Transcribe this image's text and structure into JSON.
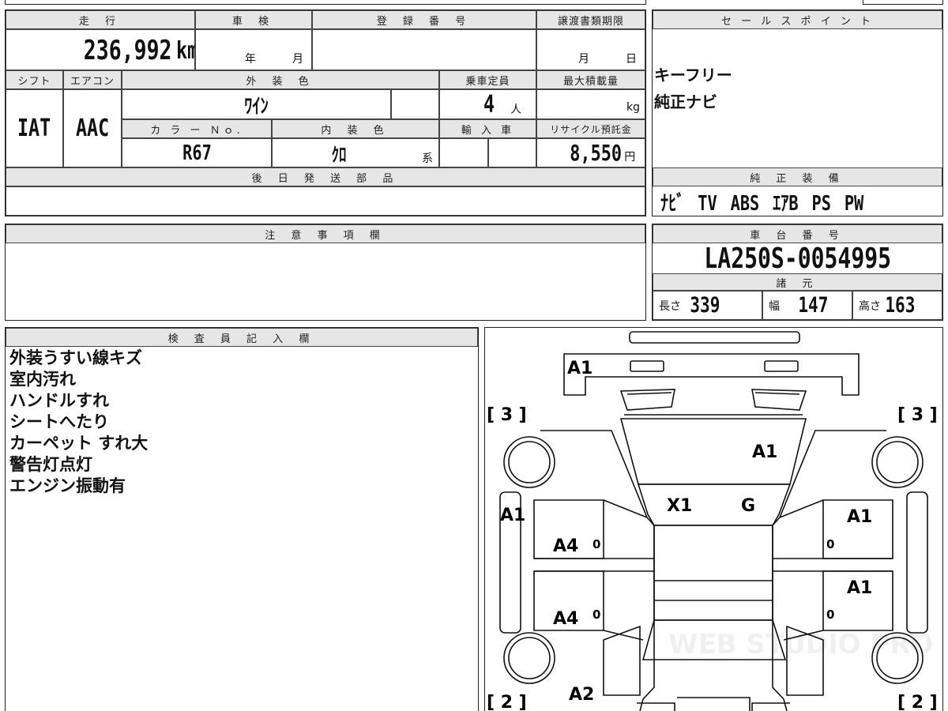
{
  "top_strip": {
    "col1": "走 行",
    "col2": "車 検",
    "col3": "登 録 番 号",
    "col4": "譲渡書類期限",
    "sales_header": "セ ー ル ス ポ イ ン ト"
  },
  "mileage": {
    "value": "236,992",
    "unit": "km"
  },
  "inspection": {
    "year_label": "年",
    "month_label": "月"
  },
  "transfer_deadline": {
    "month_label": "月",
    "day_label": "日"
  },
  "row2_headers": {
    "shift": "シフト",
    "aircon": "エアコン",
    "exterior_color": "外 装 色",
    "capacity": "乗車定員",
    "max_load": "最大積載量"
  },
  "shift": "IAT",
  "aircon": "AAC",
  "exterior_color": "ﾜｲﾝ",
  "capacity": {
    "value": "4",
    "unit": "人"
  },
  "max_load": {
    "unit": "kg"
  },
  "row3_headers": {
    "color_no": "カ ラ ー Ｎｏ.",
    "interior_color": "内 装 色",
    "import": "輸 入 車",
    "recycle": "リサイクル預託金"
  },
  "color_no": "R67",
  "interior_color": {
    "value": "ｸﾛ",
    "suffix": "系"
  },
  "recycle_fee": {
    "value": "8,550",
    "unit": "円"
  },
  "later_parts": {
    "header": "後 日 発 送 部 品"
  },
  "sales_points": [
    "キーフリー",
    "純正ナビ"
  ],
  "equipment": {
    "header": "純 正 装 備",
    "items": "ﾅﾋﾞ TV ABS ｴｱB PS PW"
  },
  "notes": {
    "header": "注 意 事 項 欄"
  },
  "chassis": {
    "header": "車 台 番 号",
    "value": "LA250S-0054995"
  },
  "specs": {
    "header": "諸 元",
    "length_label": "長さ",
    "length": "339",
    "width_label": "幅",
    "width": "147",
    "height_label": "高さ",
    "height": "163"
  },
  "inspector": {
    "header": "検 査 員 記 入 欄",
    "remarks": [
      "外装うすい線キズ",
      "室内汚れ",
      "ハンドルすれ",
      "シートへたり",
      "カーペット すれ大",
      "警告灯点灯",
      "エンジン振動有"
    ]
  },
  "diagram": {
    "corner_tl": "[ 3 ]",
    "corner_tr": "[ 3 ]",
    "corner_bl": "[ 2 ]",
    "corner_br": "[ 2 ]",
    "marks": {
      "front_bumper": "A1",
      "hood": "A1",
      "windshield_left": "X1",
      "windshield_right": "G",
      "left_fender": "A1",
      "left_front_door": "A4",
      "left_rear_door": "A4",
      "right_front_door": "A1",
      "right_rear_door": "A1",
      "left_rear": "A2",
      "door_zero_1": "0",
      "door_zero_2": "0",
      "door_zero_3": "0",
      "door_zero_4": "0"
    },
    "watermark": "WEB STUDIO PRO"
  }
}
